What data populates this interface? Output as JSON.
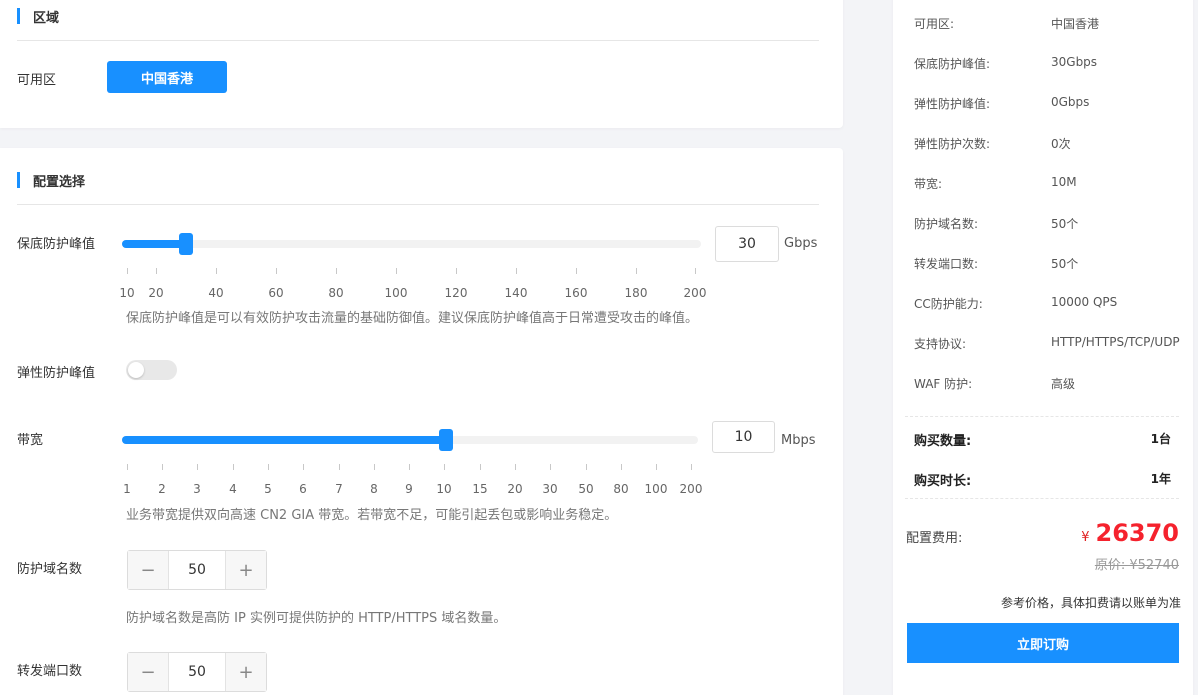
{
  "region": {
    "section_title": "区域",
    "zone_label": "可用区",
    "zone_button": "中国香港"
  },
  "config": {
    "section_title": "配置选择",
    "base_protection": {
      "label": "保底防护峰值",
      "value": "30",
      "unit": "Gbps",
      "slider_fraction": 0.111,
      "ticks": [
        "10",
        "20",
        "40",
        "60",
        "80",
        "100",
        "120",
        "140",
        "160",
        "180",
        "200"
      ],
      "description": "保底防护峰值是可以有效防护攻击流量的基础防御值。建议保底防护峰值高于日常遭受攻击的峰值。"
    },
    "elastic_protection": {
      "label": "弹性防护峰值",
      "enabled": false
    },
    "bandwidth": {
      "label": "带宽",
      "value": "10",
      "unit": "Mbps",
      "slider_fraction": 0.562,
      "ticks": [
        "1",
        "2",
        "3",
        "4",
        "5",
        "6",
        "7",
        "8",
        "9",
        "10",
        "15",
        "20",
        "30",
        "50",
        "80",
        "100",
        "200"
      ],
      "description": "业务带宽提供双向高速 CN2 GIA 带宽。若带宽不足，可能引起丢包或影响业务稳定。"
    },
    "domains": {
      "label": "防护域名数",
      "value": "50",
      "minus": "−",
      "plus": "+",
      "description": "防护域名数是高防 IP 实例可提供防护的 HTTP/HTTPS 域名数量。"
    },
    "ports": {
      "label": "转发端口数",
      "value": "50",
      "minus": "−",
      "plus": "+"
    }
  },
  "summary": {
    "rows": [
      {
        "k": "可用区:",
        "v": "中国香港"
      },
      {
        "k": "保底防护峰值:",
        "v": "30Gbps"
      },
      {
        "k": "弹性防护峰值:",
        "v": "0Gbps"
      },
      {
        "k": "弹性防护次数:",
        "v": "0次"
      },
      {
        "k": "带宽:",
        "v": "10M"
      },
      {
        "k": "防护域名数:",
        "v": "50个"
      },
      {
        "k": "转发端口数:",
        "v": "50个"
      },
      {
        "k": "CC防护能力:",
        "v": "10000 QPS"
      },
      {
        "k": "支持协议:",
        "v": "HTTP/HTTPS/TCP/UDP"
      },
      {
        "k": "WAF 防护:",
        "v": "高级"
      }
    ],
    "quantity_label": "购买数量:",
    "quantity_value": "1台",
    "duration_label": "购买时长:",
    "duration_value": "1年",
    "fee_label": "配置费用:",
    "currency": "¥",
    "price": "26370",
    "original_price": "原价: ¥52740",
    "note": "参考价格，具体扣费请以账单为准",
    "order_button": "立即订购"
  },
  "colors": {
    "accent": "#1890ff",
    "price": "#f5222d"
  }
}
